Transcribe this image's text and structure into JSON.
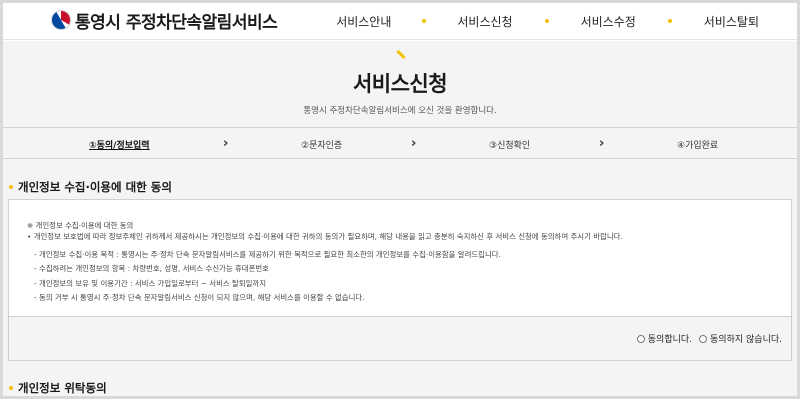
{
  "header": {
    "logo_text": "통영시 주정차단속알림서비스",
    "nav": [
      "서비스안내",
      "서비스신청",
      "서비스수정",
      "서비스탈퇴"
    ]
  },
  "page": {
    "title": "서비스신청",
    "subtitle": "통영시 주정차단속알림서비스에 오신 것을 환영합니다."
  },
  "steps": [
    {
      "label": "①동의/정보입력",
      "active": true
    },
    {
      "label": "②문자인증"
    },
    {
      "label": "③신청확인"
    },
    {
      "label": "④가입완료"
    }
  ],
  "step_arrow": "›",
  "section1": {
    "title": "개인정보 수집·이용에 대한 동의",
    "notice_title": "※ 개인정보 수집·이용에 대한 동의",
    "intro": "• 개인정보 보호법에 따라 정보주체인 귀하께서 제공하시는 개인정보의 수집·이용에 대한 귀하의 동의가 필요하며, 해당 내용을 읽고 충분히 숙지하신 후 서비스 신청에 동의하여 주시기 바랍니다.",
    "items": [
      "- 개인정보 수집·이용 목적 : 통영시는 주·정차 단속 문자알림서비스를 제공하기 위한 목적으로 필요한 최소한의 개인정보를 수집·이용함을 알려드립니다.",
      "- 수집하려는 개인정보의 항목 : 차량번호, 성명, 서비스 수신가능 휴대폰번호",
      "- 개인정보의 보유 및 이용기간 : 서비스 가입일로부터 ~ 서비스 탈퇴일까지",
      "- 동의 거부 시 통영시 주·정차 단속 문자알림서비스 신청이 되지 않으며, 해당 서비스를 이용할 수 없습니다."
    ],
    "agree_label": "동의합니다.",
    "disagree_label": "동의하지 않습니다."
  },
  "section2": {
    "title": "개인정보 위탁동의"
  },
  "colors": {
    "accent": "#f2c200",
    "background": "#f4f4f4"
  }
}
